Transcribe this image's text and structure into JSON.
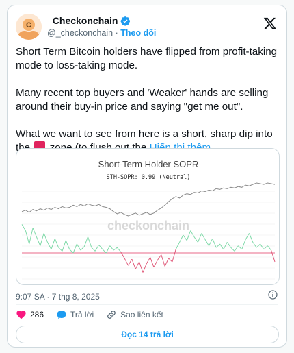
{
  "author": {
    "display_name": "_Checkonchain",
    "handle": "@_checkonchain",
    "separator": "·",
    "follow_label": "Theo dõi"
  },
  "tweet": {
    "paragraph_1": "Short Term Bitcoin holders have flipped from profit-taking mode to loss-taking mode.",
    "paragraph_2": "Many recent top buyers and 'Weaker' hands are selling around their buy-in price and saying \"get me out\".",
    "paragraph_3_before": "What we want to see from here is a short, sharp dip into the",
    "paragraph_3_after": "zone (to flush out the",
    "show_more": "Hiển thị thêm",
    "zone_color": "#e0245e"
  },
  "chart": {
    "title": "Short-Term Holder SOPR",
    "subtitle": "STH-SOPR: 0.99 (Neutral)",
    "watermark": "checkonchain",
    "colors": {
      "price": "#8a8a8a",
      "sopr_above": "#7fd9a8",
      "sopr_below": "#e05a7a",
      "baseline": "#e86a8a",
      "grid": "#eeeeee"
    }
  },
  "chart_data": {
    "type": "line",
    "title": "Short-Term Holder SOPR",
    "subtitle": "STH-SOPR: 0.99 (Neutral)",
    "baseline": 1.0,
    "series": [
      {
        "values": [
          1.032,
          1.025,
          1.01,
          1.028,
          1.018,
          1.008,
          1.022,
          1.012,
          1.004,
          1.016,
          1.006,
          1.002,
          1.014,
          1.004,
          1.0,
          1.01,
          1.003,
          1.007,
          1.018,
          1.006,
          1.002,
          1.009,
          1.004,
          1.0,
          1.008,
          1.003,
          1.006,
          1.001,
          0.994,
          0.986,
          0.993,
          0.982,
          0.99,
          0.978,
          0.988,
          0.995,
          0.984,
          0.992,
          0.998,
          0.985,
          0.994,
          0.99,
          1.004,
          1.012,
          1.02,
          1.014,
          1.025,
          1.018,
          1.012,
          1.022,
          1.015,
          1.008,
          1.016,
          1.006,
          1.01,
          1.004,
          1.012,
          1.006,
          1.002,
          1.008,
          1.004,
          1.015,
          1.022,
          1.012,
          1.006,
          1.01,
          1.004,
          1.008,
          1.003,
          0.99
        ]
      },
      {
        "values": [
          74,
          76,
          73,
          77,
          75,
          78,
          76,
          79,
          77,
          80,
          78,
          81,
          79,
          80,
          83,
          81,
          84,
          82,
          85,
          83,
          82,
          84,
          81,
          80,
          78,
          74,
          71,
          73,
          70,
          68,
          70,
          72,
          69,
          71,
          73,
          70,
          72,
          76,
          79,
          83,
          88,
          92,
          95,
          93,
          97,
          99,
          98,
          101,
          100,
          103,
          102,
          104,
          103,
          106,
          105,
          107,
          106,
          108,
          107,
          109,
          108,
          111,
          110,
          112,
          114,
          113,
          112,
          114,
          113,
          112
        ]
      }
    ]
  },
  "meta": {
    "time": "9:07 SA",
    "separator": "·",
    "date": "7 thg 8, 2025"
  },
  "actions": {
    "like_count": "286",
    "reply_label": "Trả lời",
    "copy_link_label": "Sao liên kết",
    "read_replies_label": "Đọc 14 trả lời"
  }
}
